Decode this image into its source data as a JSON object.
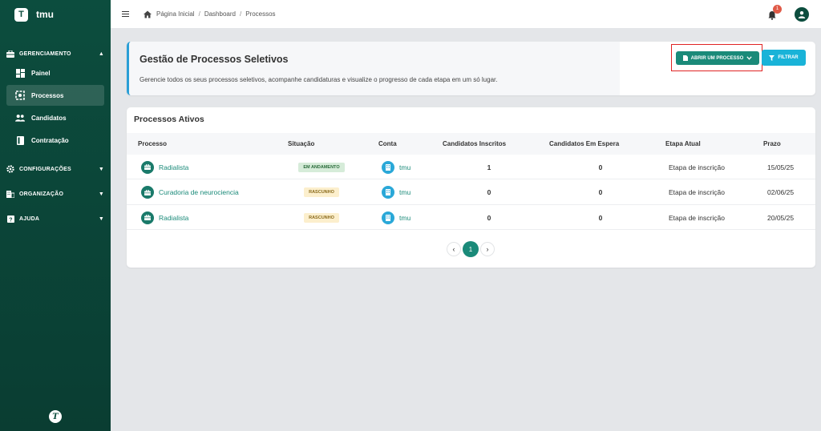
{
  "app": {
    "brand_letter": "T",
    "name": "tmu",
    "footer_logo_letter": "T"
  },
  "sidebar": {
    "sections": [
      {
        "label": "GERENCIAMENTO",
        "icon": "toolbox-icon",
        "expanded": true,
        "items": [
          {
            "label": "Painel",
            "icon": "dashboard-icon",
            "active": false
          },
          {
            "label": "Processos",
            "icon": "process-icon",
            "active": true
          },
          {
            "label": "Candidatos",
            "icon": "people-icon",
            "active": false
          },
          {
            "label": "Contratação",
            "icon": "contract-icon",
            "active": false
          }
        ]
      },
      {
        "label": "CONFIGURAÇÕES",
        "icon": "gear-icon",
        "expanded": false
      },
      {
        "label": "ORGANIZAÇÃO",
        "icon": "building-icon",
        "expanded": false
      },
      {
        "label": "AJUDA",
        "icon": "help-icon",
        "expanded": false
      }
    ]
  },
  "topbar": {
    "breadcrumb": [
      "Página Inicial",
      "Dashboard",
      "Processos"
    ],
    "notifications_count": "1"
  },
  "header": {
    "title": "Gestão de Processos Seletivos",
    "subtitle": "Gerencie todos os seus processos seletivos, acompanhe candidaturas e visualize o progresso de cada etapa em um só lugar.",
    "open_button": "ABRIR UM PROCESSO",
    "filter_button": "FILTRAR"
  },
  "table": {
    "title": "Processos Ativos",
    "columns": [
      "Processo",
      "Situação",
      "Conta",
      "Candidatos Inscritos",
      "Candidatos Em Espera",
      "Etapa Atual",
      "Prazo"
    ],
    "rows": [
      {
        "process": "Radialista",
        "status": "EM ANDAMENTO",
        "status_color": "green",
        "account": "tmu",
        "enrolled": "1",
        "waiting": "0",
        "stage": "Etapa de inscrição",
        "deadline": "15/05/25"
      },
      {
        "process": "Curadoria de neurociencia",
        "status": "RASCUNHO",
        "status_color": "yellow",
        "account": "tmu",
        "enrolled": "0",
        "waiting": "0",
        "stage": "Etapa de inscrição",
        "deadline": "02/06/25"
      },
      {
        "process": "Radialista",
        "status": "RASCUNHO",
        "status_color": "yellow",
        "account": "tmu",
        "enrolled": "0",
        "waiting": "0",
        "stage": "Etapa de inscrição",
        "deadline": "20/05/25"
      }
    ]
  },
  "pagination": {
    "current_page": "1"
  },
  "colors": {
    "sidebar": "#0c4d3e",
    "accent": "#1a8a79",
    "filter": "#19b3d8",
    "highlight_border": "#e02424"
  }
}
